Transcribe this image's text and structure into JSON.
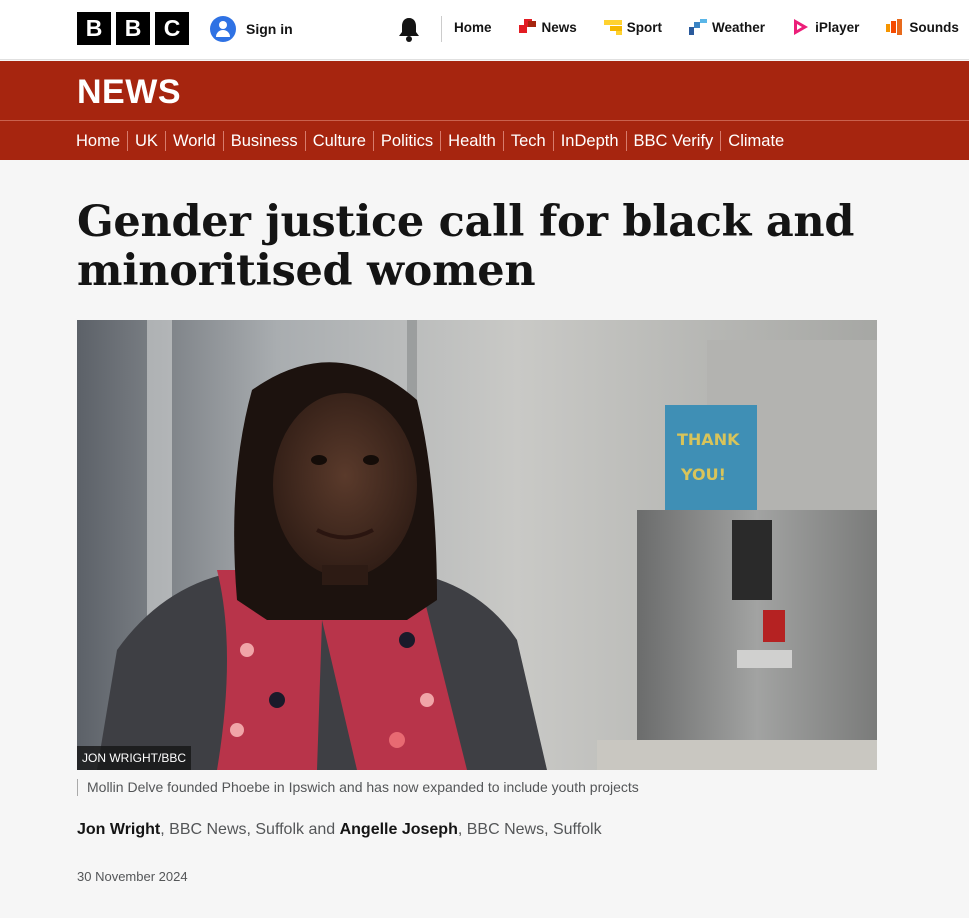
{
  "topbar": {
    "logo_letters": [
      "B",
      "B",
      "C"
    ],
    "sign_in_label": "Sign in",
    "nav": [
      {
        "label": "Home",
        "icon": "none"
      },
      {
        "label": "News",
        "icon": "news-icon",
        "color": "#e31c23"
      },
      {
        "label": "Sport",
        "icon": "sport-icon",
        "color": "#ffd230"
      },
      {
        "label": "Weather",
        "icon": "weather-icon",
        "color": "#3b84c4"
      },
      {
        "label": "iPlayer",
        "icon": "iplayer-icon",
        "color": "#ec1e79"
      },
      {
        "label": "Sounds",
        "icon": "sounds-icon",
        "color": "#f54a00"
      }
    ]
  },
  "banner": {
    "title": "NEWS",
    "color": "#a6250f"
  },
  "section_nav": [
    "Home",
    "UK",
    "World",
    "Business",
    "Culture",
    "Politics",
    "Health",
    "Tech",
    "InDepth",
    "BBC Verify",
    "Climate"
  ],
  "article": {
    "headline": "Gender justice call for black and minoritised women",
    "image_credit": "JON WRIGHT/BBC",
    "caption": "Mollin Delve founded Phoebe in Ipswich and has now expanded to include youth projects",
    "byline": {
      "author1": "Jon Wright",
      "org1": ", BBC News, Suffolk and ",
      "author2": "Angelle Joseph",
      "org2": ", BBC News, Suffolk"
    },
    "date": "30 November 2024"
  }
}
